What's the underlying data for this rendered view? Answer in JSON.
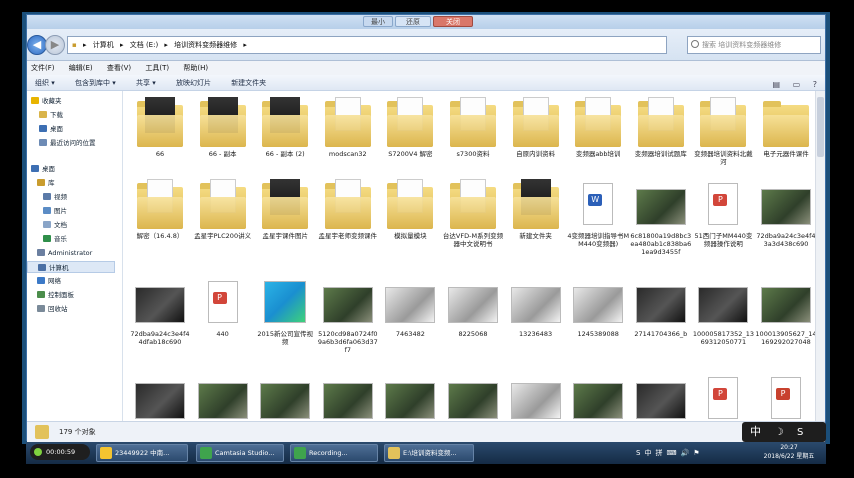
{
  "window": {
    "title_buttons": [
      "最小",
      "还原",
      "关闭"
    ]
  },
  "address": {
    "breadcrumb": [
      "计算机",
      "文档 (E:)",
      "培训资料变频器维修"
    ],
    "search_placeholder": "搜索 培训资料变频器维修"
  },
  "menu": [
    "文件(F)",
    "编辑(E)",
    "查看(V)",
    "工具(T)",
    "帮助(H)"
  ],
  "toolbar": [
    "组织 ▾",
    "包含到库中 ▾",
    "共享 ▾",
    "放映幻灯片",
    "新建文件夹"
  ],
  "navpane": [
    {
      "label": "收藏夹",
      "icon": "star-icon",
      "color": "#e8b400"
    },
    {
      "label": "下载",
      "icon": "download-folder-icon",
      "color": "#d9b44a"
    },
    {
      "label": "桌面",
      "icon": "desktop-icon",
      "color": "#3d6fb3"
    },
    {
      "label": "最近访问的位置",
      "icon": "recent-icon",
      "color": "#6d8bb5"
    },
    {
      "label": "桌面",
      "icon": "desktop-icon",
      "color": "#3d6fb3"
    },
    {
      "label": "库",
      "icon": "library-icon",
      "color": "#c99c2e"
    },
    {
      "label": "视频",
      "icon": "video-icon",
      "color": "#5b7aa8"
    },
    {
      "label": "图片",
      "icon": "pictures-icon",
      "color": "#5b8cc5"
    },
    {
      "label": "文档",
      "icon": "documents-icon",
      "color": "#8aa5c8"
    },
    {
      "label": "音乐",
      "icon": "music-icon",
      "color": "#2f8f4a"
    },
    {
      "label": "Administrator",
      "icon": "user-icon",
      "color": "#6b7fa0"
    },
    {
      "label": "计算机",
      "icon": "computer-icon",
      "color": "#4a6fa5"
    },
    {
      "label": "网络",
      "icon": "network-icon",
      "color": "#3b79c7"
    },
    {
      "label": "控制面板",
      "icon": "control-panel-icon",
      "color": "#4b8d4b"
    },
    {
      "label": "回收站",
      "icon": "recycle-bin-icon",
      "color": "#7a8a99"
    }
  ],
  "files": [
    {
      "name": "66",
      "kind": "folder-dark"
    },
    {
      "name": "66 - 副本",
      "kind": "folder-dark"
    },
    {
      "name": "66 - 副本 (2)",
      "kind": "folder-dark"
    },
    {
      "name": "modscan32",
      "kind": "folder-paper"
    },
    {
      "name": "S7200V4 解密",
      "kind": "folder-paper"
    },
    {
      "name": "s7300资料",
      "kind": "folder-paper"
    },
    {
      "name": "自原内训资料",
      "kind": "folder-paper"
    },
    {
      "name": "变频器abb培训",
      "kind": "folder-paper"
    },
    {
      "name": "变频器培训试题库",
      "kind": "folder-paper"
    },
    {
      "name": "变频器培训资料北戴河",
      "kind": "folder-paper"
    },
    {
      "name": "电子元器件课件",
      "kind": "folder-plain"
    },
    {
      "name": "解密（16.4.8）",
      "kind": "folder-paper"
    },
    {
      "name": "孟星宇PLC200讲义",
      "kind": "folder-paper"
    },
    {
      "name": "孟星宇课件图片",
      "kind": "folder-dark"
    },
    {
      "name": "孟星宇老师变频课件",
      "kind": "folder-paper"
    },
    {
      "name": "模拟量模块",
      "kind": "folder-paper"
    },
    {
      "name": "台达VFD-M系列变频器中文说明书",
      "kind": "folder-paper"
    },
    {
      "name": "新建文件夹",
      "kind": "folder-dark"
    },
    {
      "name": "4变频器培训指导书MM440变频器)",
      "kind": "doc-word"
    },
    {
      "name": "6c81800a19d8bc3ea480ab1c838ba61ea9d3455f",
      "kind": "photo-board"
    },
    {
      "name": "51西门子MM440变频器操作说明",
      "kind": "doc-pdf"
    },
    {
      "name": "72dba9a24c3e4f43a3d438c690",
      "kind": "photo-board"
    },
    {
      "name": "72dba9a24c3e4f44dfab18c690",
      "kind": "photo-dark"
    },
    {
      "name": "440",
      "kind": "doc-pdf"
    },
    {
      "name": "2015新公司宣传视频",
      "kind": "video"
    },
    {
      "name": "5120cd98a0724f09a6b3d6fa063d37f7",
      "kind": "photo-board"
    },
    {
      "name": "7463482",
      "kind": "photo-grey"
    },
    {
      "name": "8225068",
      "kind": "photo-grey"
    },
    {
      "name": "13236483",
      "kind": "photo-grey"
    },
    {
      "name": "1245389088",
      "kind": "photo-grey"
    },
    {
      "name": "27141704366_b",
      "kind": "photo-dark"
    },
    {
      "name": "100005817352_1369312050771",
      "kind": "photo-dark"
    },
    {
      "name": "100013905627_14169292027048",
      "kind": "photo-board"
    },
    {
      "name": "",
      "kind": "photo-dark"
    },
    {
      "name": "",
      "kind": "photo-board"
    },
    {
      "name": "",
      "kind": "photo-board"
    },
    {
      "name": "",
      "kind": "photo-board"
    },
    {
      "name": "",
      "kind": "photo-board"
    },
    {
      "name": "",
      "kind": "photo-board"
    },
    {
      "name": "",
      "kind": "photo-grey"
    },
    {
      "name": "",
      "kind": "photo-board"
    },
    {
      "name": "",
      "kind": "photo-dark"
    },
    {
      "name": "",
      "kind": "doc-pdf"
    },
    {
      "name": "",
      "kind": "doc-ppt"
    }
  ],
  "status": {
    "count_text": "179 个对象"
  },
  "taskbar": {
    "recorder": "00:00:59",
    "items": [
      {
        "label": "23449922 中南...",
        "color": "#f4c430"
      },
      {
        "label": "Camtasia Studio...",
        "color": "#3fa34d"
      },
      {
        "label": "Recording...",
        "color": "#3fa34d"
      },
      {
        "label": "E:\\培训资料变频...",
        "color": "#e2c25b"
      }
    ],
    "tray": [
      "S",
      "中",
      "拼",
      "⌨",
      "🔊",
      "⚑"
    ],
    "time": "20:27",
    "date": "2018/6/22 星期五"
  },
  "ime": {
    "mode": "中",
    "moon": "☽",
    "logo": "S"
  },
  "colors": {
    "accent": "#3d6fb3",
    "folder": "#e2c25b",
    "window_border": "#3b6ea5"
  }
}
